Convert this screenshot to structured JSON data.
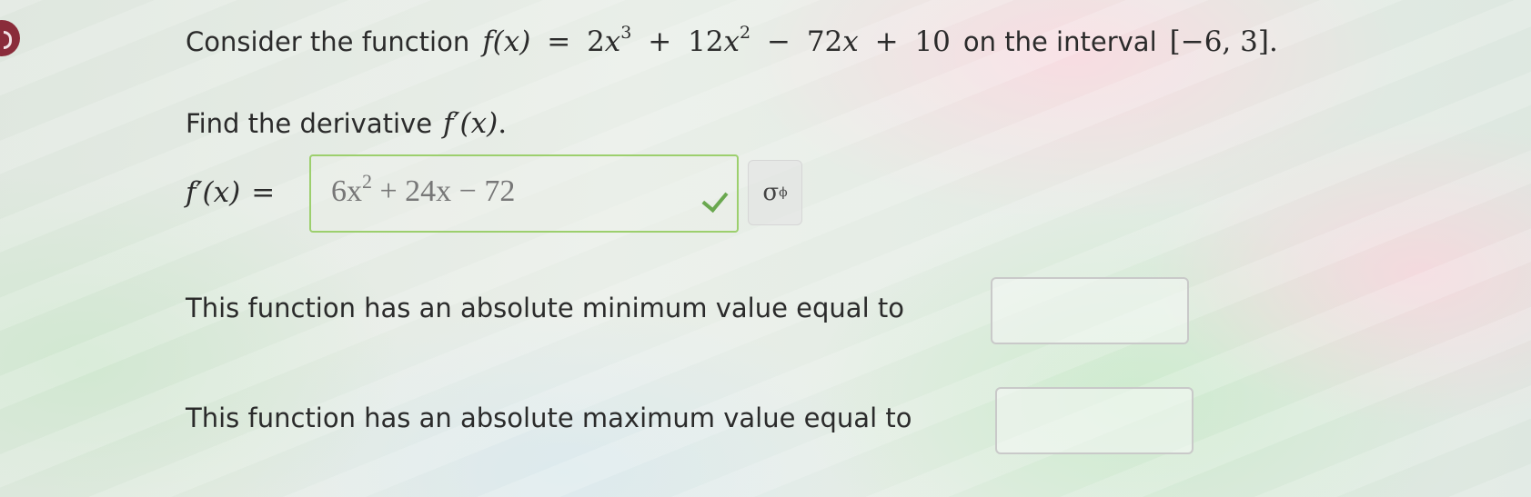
{
  "question": {
    "intro_text": "Consider the function",
    "function_lhs": "f(x)",
    "equals": "=",
    "function_rhs": {
      "t1_coef": "2",
      "t1_var": "x",
      "t1_exp": "3",
      "plus1": "+",
      "t2_coef": "12",
      "t2_var": "x",
      "t2_exp": "2",
      "minus": "−",
      "t3_coef": "72",
      "t3_var": "x",
      "plus2": "+",
      "t4": "10"
    },
    "interval_text": "on the interval",
    "interval": "[−6, 3]",
    "period": "."
  },
  "derivative": {
    "prompt_text": "Find the derivative",
    "prompt_symbol": "f′(x)",
    "prompt_period": ".",
    "answer_label": "f′(x)",
    "answer_equals": "=",
    "answer_value": {
      "part1": "6x",
      "exp": "2",
      "part2": " + 24x − 72"
    },
    "check_icon": "checkmark-icon",
    "symbol_button": {
      "base": "σ",
      "sup": "ϕ"
    }
  },
  "minimum": {
    "label": "This function has an absolute minimum value equal to",
    "value": ""
  },
  "maximum": {
    "label": "This function has an absolute maximum value equal to",
    "value": ""
  },
  "colors": {
    "correct_border": "#9ccf6d",
    "check": "#6aa84f",
    "corner_dot": "#8a2c3a"
  }
}
